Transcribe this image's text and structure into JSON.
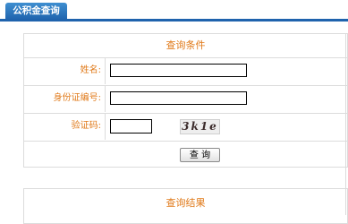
{
  "tab": {
    "label": "公积金查询"
  },
  "query": {
    "title": "查询条件",
    "name_label": "姓名:",
    "name_value": "",
    "id_label": "身份证编号:",
    "id_value": "",
    "captcha_label": "验证码:",
    "captcha_value": "",
    "captcha_text": "3k1e",
    "submit_label": "查 询"
  },
  "result": {
    "title": "查询结果"
  }
}
